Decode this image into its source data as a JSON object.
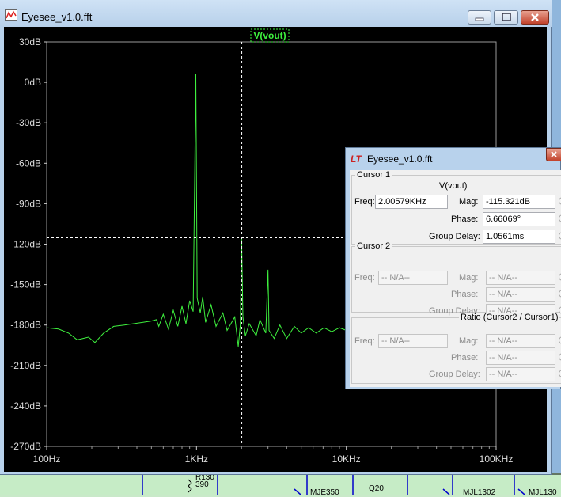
{
  "main_window": {
    "title": "Eyesee_v1.0.fft",
    "trace_label": "V(vout)"
  },
  "chart_data": {
    "type": "line",
    "x_scale": "log",
    "xlim_hz": [
      100,
      100000
    ],
    "ylim_db": [
      -270,
      30
    ],
    "x_ticks": [
      "100Hz",
      "1KHz",
      "10KHz",
      "100KHz"
    ],
    "y_ticks": [
      "30dB",
      "0dB",
      "-30dB",
      "-60dB",
      "-90dB",
      "-120dB",
      "-150dB",
      "-180dB",
      "-210dB",
      "-240dB",
      "-270dB"
    ],
    "grid": true,
    "trace_color": "#3ef03e",
    "cursor": {
      "x_hz": 2005.79,
      "y_db": -115.321
    },
    "series": [
      {
        "name": "V(vout)",
        "points": [
          [
            100,
            -182
          ],
          [
            120,
            -183
          ],
          [
            140,
            -186
          ],
          [
            160,
            -191
          ],
          [
            190,
            -189
          ],
          [
            210,
            -193
          ],
          [
            240,
            -186
          ],
          [
            280,
            -181
          ],
          [
            330,
            -180
          ],
          [
            380,
            -179
          ],
          [
            440,
            -178
          ],
          [
            500,
            -177
          ],
          [
            540,
            -176
          ],
          [
            560,
            -181
          ],
          [
            600,
            -172
          ],
          [
            650,
            -183
          ],
          [
            700,
            -169
          ],
          [
            750,
            -181
          ],
          [
            800,
            -166
          ],
          [
            850,
            -179
          ],
          [
            900,
            -162
          ],
          [
            950,
            -170
          ],
          [
            990,
            6
          ],
          [
            1010,
            -160
          ],
          [
            1060,
            -171
          ],
          [
            1100,
            -159
          ],
          [
            1150,
            -178
          ],
          [
            1250,
            -165
          ],
          [
            1350,
            -181
          ],
          [
            1500,
            -171
          ],
          [
            1600,
            -184
          ],
          [
            1800,
            -174
          ],
          [
            1900,
            -196
          ],
          [
            1960,
            -180
          ],
          [
            2000,
            -116
          ],
          [
            2040,
            -174
          ],
          [
            2120,
            -188
          ],
          [
            2250,
            -179
          ],
          [
            2500,
            -188
          ],
          [
            2650,
            -176
          ],
          [
            2900,
            -186
          ],
          [
            3000,
            -139
          ],
          [
            3050,
            -184
          ],
          [
            3300,
            -190
          ],
          [
            3600,
            -180
          ],
          [
            4000,
            -190
          ],
          [
            4500,
            -181
          ],
          [
            5000,
            -186
          ],
          [
            5600,
            -182
          ],
          [
            6300,
            -186
          ],
          [
            7100,
            -182
          ],
          [
            8000,
            -185
          ],
          [
            9000,
            -182
          ],
          [
            10000,
            -184
          ],
          [
            11500,
            -183
          ],
          [
            13000,
            -184
          ]
        ]
      }
    ]
  },
  "cursor_dialog": {
    "title": "Eyesee_v1.0.fft",
    "cursor1": {
      "group_label": "Cursor 1",
      "trace": "V(vout)",
      "freq_label": "Freq:",
      "freq_value": "2.00579KHz",
      "mag_label": "Mag:",
      "mag_value": "-115.321dB",
      "phase_label": "Phase:",
      "phase_value": "6.66069°",
      "group_delay_label": "Group Delay:",
      "group_delay_value": "1.0561ms"
    },
    "cursor2": {
      "group_label": "Cursor 2",
      "freq_label": "Freq:",
      "freq_value": "-- N/A--",
      "mag_label": "Mag:",
      "mag_value": "-- N/A--",
      "phase_label": "Phase:",
      "phase_value": "-- N/A--",
      "group_delay_label": "Group Delay:",
      "group_delay_value": "-- N/A--"
    },
    "ratio": {
      "group_label": "Ratio (Cursor2 / Cursor1)",
      "freq_label": "Freq:",
      "freq_value": "-- N/A--",
      "mag_label": "Mag:",
      "mag_value": "-- N/A--",
      "phase_label": "Phase:",
      "phase_value": "-- N/A--",
      "group_delay_label": "Group Delay:",
      "group_delay_value": "-- N/A--"
    }
  },
  "schematic": {
    "labels": [
      "R130",
      "390",
      "MJE350",
      "Q20",
      "MJL1302",
      "MJL130"
    ]
  }
}
